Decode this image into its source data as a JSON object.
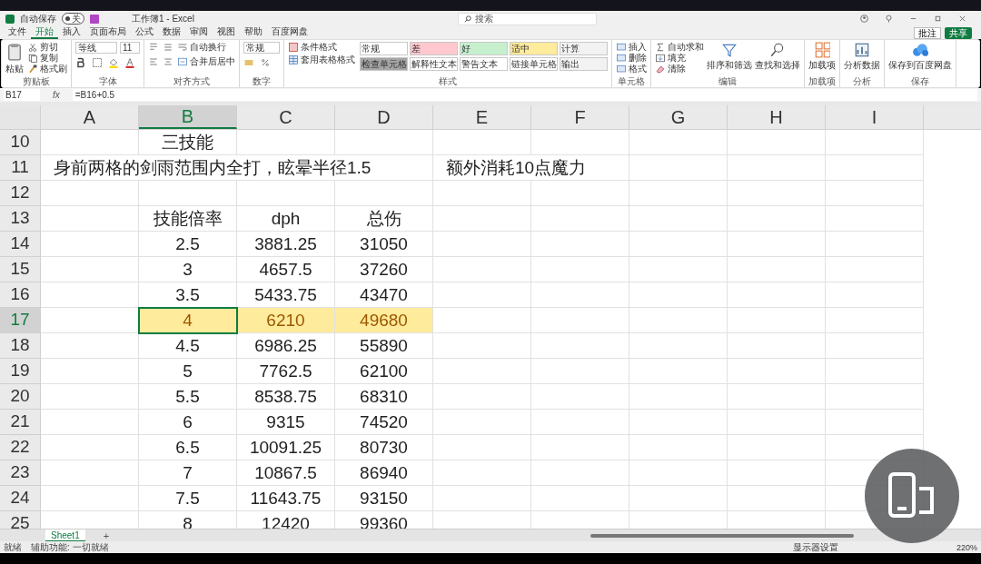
{
  "title_bar": {
    "autosave": "自动保存",
    "autosave_state": "关",
    "autosave_on": false,
    "title": "工作簿1 - Excel",
    "search": {
      "placeholder": "搜索"
    }
  },
  "menu_tabs": [
    {
      "label": "文件",
      "selected": false
    },
    {
      "label": "开始",
      "selected": true
    },
    {
      "label": "插入",
      "selected": false
    },
    {
      "label": "页面布局",
      "selected": false
    },
    {
      "label": "公式",
      "selected": false
    },
    {
      "label": "数据",
      "selected": false
    },
    {
      "label": "审阅",
      "selected": false
    },
    {
      "label": "视图",
      "selected": false
    },
    {
      "label": "帮助",
      "selected": false
    },
    {
      "label": "百度网盘",
      "selected": false
    }
  ],
  "top_buttons": [
    "批注",
    "共享"
  ],
  "ribbon_groups": [
    {
      "label": "剪贴板",
      "kind": "clipboard",
      "items": [
        "粘贴",
        "剪切",
        "复制",
        "格式刷"
      ]
    },
    {
      "label": "字体",
      "kind": "font",
      "items": [
        "等线",
        "11"
      ]
    },
    {
      "label": "对齐方式",
      "kind": "alignment",
      "items": [
        "自动换行",
        "合并后居中"
      ]
    },
    {
      "label": "数字",
      "kind": "number",
      "items": [
        "常规"
      ]
    },
    {
      "label": "样式",
      "kind": "styles",
      "items": [
        "条件格式",
        "套用表格格式"
      ],
      "styles": [
        {
          "label": "常规",
          "color": "#ffffff"
        },
        {
          "label": "差",
          "color": "#ffc7ce"
        },
        {
          "label": "好",
          "color": "#c6efce"
        },
        {
          "label": "适中",
          "color": "#ffeb9c"
        },
        {
          "label": "计算",
          "color": "#f2f2f2"
        },
        {
          "label": "检查单元格",
          "color": "#a5a5a5"
        },
        {
          "label": "解释性文本",
          "color": "#ffffff"
        },
        {
          "label": "警告文本",
          "color": "#ffffff"
        },
        {
          "label": "链接单元格",
          "color": "#ffffff"
        },
        {
          "label": "输出",
          "color": "#f2f2f2"
        }
      ]
    },
    {
      "label": "单元格",
      "kind": "cells",
      "items": [
        "插入",
        "删除",
        "格式"
      ]
    },
    {
      "label": "编辑",
      "kind": "editing",
      "items": [
        "自动求和",
        "填充",
        "清除",
        "排序和筛选",
        "查找和选择"
      ]
    },
    {
      "label": "加载项",
      "kind": "addins",
      "items": [
        "加载项"
      ]
    },
    {
      "label": "分析",
      "kind": "analysis",
      "items": [
        "分析数据"
      ]
    },
    {
      "label": "保存",
      "kind": "cloud",
      "items": [
        "保存到百度网盘"
      ]
    }
  ],
  "formula_bar": {
    "name_box": "B17",
    "fx": "fx",
    "formula": "=B16+0.5"
  },
  "columns": [
    {
      "label": "A",
      "selected": false
    },
    {
      "label": "B",
      "selected": true
    },
    {
      "label": "C",
      "selected": false
    },
    {
      "label": "D",
      "selected": false
    },
    {
      "label": "E",
      "selected": false
    },
    {
      "label": "F",
      "selected": false
    },
    {
      "label": "G",
      "selected": false
    },
    {
      "label": "H",
      "selected": false
    },
    {
      "label": "I",
      "selected": false
    }
  ],
  "rows": [
    {
      "header": "10",
      "selected": false,
      "styled": false,
      "b": "三技能"
    },
    {
      "header": "11",
      "selected": false,
      "styled": false,
      "a": "身前两格的剑雨范围内全打，眩晕半径1.5",
      "e": "额外消耗10点魔力"
    },
    {
      "header": "12",
      "selected": false,
      "styled": false
    },
    {
      "header": "13",
      "selected": false,
      "styled": false,
      "b": "技能倍率",
      "c": "dph",
      "d": "总伤"
    },
    {
      "header": "14",
      "selected": false,
      "styled": false,
      "b": "2.5",
      "c": "3881.25",
      "d": "31050"
    },
    {
      "header": "15",
      "selected": false,
      "styled": false,
      "b": "3",
      "c": "4657.5",
      "d": "37260"
    },
    {
      "header": "16",
      "selected": false,
      "styled": false,
      "b": "3.5",
      "c": "5433.75",
      "d": "43470"
    },
    {
      "header": "17",
      "selected": true,
      "styled": true,
      "b": "4",
      "c": "6210",
      "d": "49680"
    },
    {
      "header": "18",
      "selected": false,
      "styled": false,
      "b": "4.5",
      "c": "6986.25",
      "d": "55890"
    },
    {
      "header": "19",
      "selected": false,
      "styled": false,
      "b": "5",
      "c": "7762.5",
      "d": "62100"
    },
    {
      "header": "20",
      "selected": false,
      "styled": false,
      "b": "5.5",
      "c": "8538.75",
      "d": "68310"
    },
    {
      "header": "21",
      "selected": false,
      "styled": false,
      "b": "6",
      "c": "9315",
      "d": "74520"
    },
    {
      "header": "22",
      "selected": false,
      "styled": false,
      "b": "6.5",
      "c": "10091.25",
      "d": "80730"
    },
    {
      "header": "23",
      "selected": false,
      "styled": false,
      "b": "7",
      "c": "10867.5",
      "d": "86940"
    },
    {
      "header": "24",
      "selected": false,
      "styled": false,
      "b": "7.5",
      "c": "11643.75",
      "d": "93150"
    },
    {
      "header": "25",
      "selected": false,
      "styled": false,
      "b": "8",
      "c": "12420",
      "d": "99360"
    }
  ],
  "sheet_tabs": [
    {
      "label": "Sheet1",
      "selected": true
    }
  ],
  "add_sheet": "+",
  "status_bar": {
    "left": [
      "就绪",
      "辅助功能: 一切就绪"
    ],
    "display": "显示器设置",
    "zoom": "220%"
  }
}
